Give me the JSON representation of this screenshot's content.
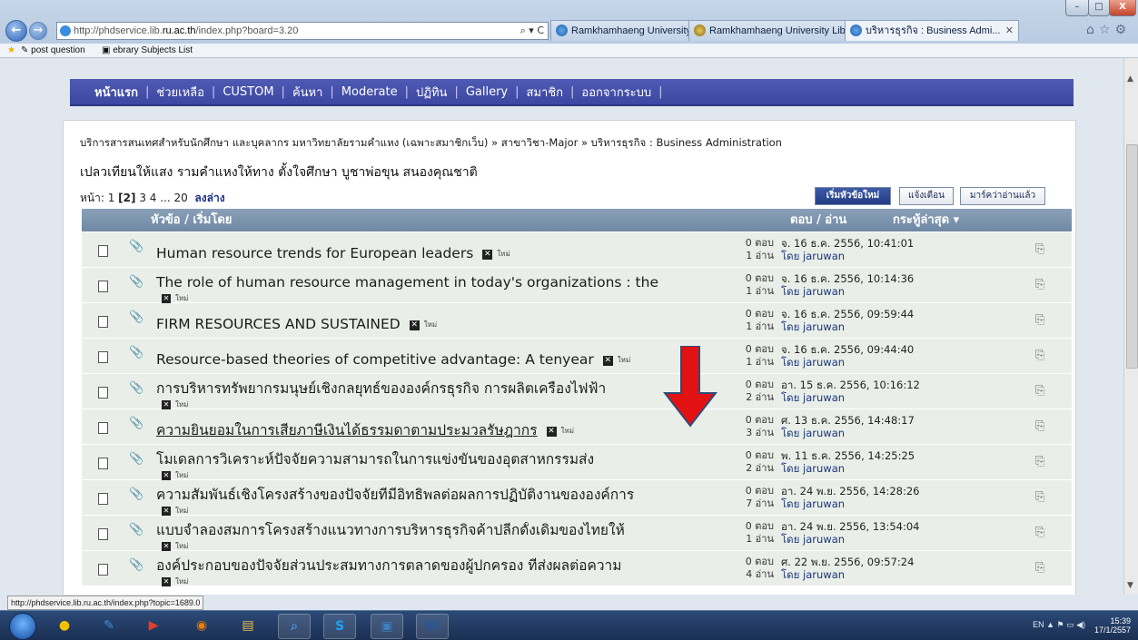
{
  "browser": {
    "address": {
      "prefix": "http://phdservice.lib.",
      "domain": "ru.ac.th",
      "suffix": "/index.php?board=3.20"
    },
    "addr_icons": "⌕ ▾ C",
    "tabs": [
      {
        "label": "Ramkhamhaeng University Lib..."
      },
      {
        "label": "Ramkhamhaeng University Lib..."
      },
      {
        "label": "บริหารธุรกิจ : Business Admi..."
      }
    ],
    "tab_close": "✕",
    "nav_right": "⌂☆⚙",
    "favorites": [
      "post question",
      "ebrary Subjects List"
    ],
    "window_buttons": {
      "minimize": "–",
      "maximize": "□",
      "close": "X"
    }
  },
  "menu": [
    "หน้าแรก",
    "ช่วยเหลือ",
    "CUSTOM",
    "ค้นหา",
    "Moderate",
    "ปฏิทิน",
    "Gallery",
    "สมาชิก",
    "ออกจากระบบ"
  ],
  "breadcrumb": "บริการสารสนเทศสำหรับนักศึกษา และบุคลากร มหาวิทยาลัยรามคำแหง (เฉพาะสมาชิกเว็บ) » สาขาวิชา-Major » บริหารธุรกิจ : Business Administration",
  "motto": "เปลวเทียนให้แสง รามคำแหงให้ทาง ตั้งใจศึกษา บูชาพ่อขุน สนองคุณชาติ",
  "pager": {
    "label": "หน้า: 1",
    "current": "[2]",
    "pages": "3 4 ... 20",
    "bottom": "ลงล่าง"
  },
  "buttons": {
    "new_topic": "เริ่มหัวข้อใหม่",
    "notify": "แจ้งเตือน",
    "mark_read": "มาร์คว่าอ่านแล้ว"
  },
  "table": {
    "col_subject": "หัวข้อ / เริ่มโดย",
    "col_replies": "ตอบ / อ่าน",
    "col_last": "กระทู้ล่าสุด ▾",
    "new_label": "ใหม่",
    "rows": [
      {
        "subject": "Human resource trends for European leaders",
        "replies": "0 ตอบ",
        "views": "1 อ่าน",
        "date": "จ. 16 ธ.ค. 2556, 10:41:01",
        "by": "โดย jaruwan",
        "new_inline": true
      },
      {
        "subject": "The role of human resource management in today's organizations : the",
        "replies": "0 ตอบ",
        "views": "1 อ่าน",
        "date": "จ. 16 ธ.ค. 2556, 10:14:36",
        "by": "โดย jaruwan",
        "new_inline": false
      },
      {
        "subject": "FIRM RESOURCES AND SUSTAINED",
        "replies": "0 ตอบ",
        "views": "1 อ่าน",
        "date": "จ. 16 ธ.ค. 2556, 09:59:44",
        "by": "โดย jaruwan",
        "new_inline": true
      },
      {
        "subject": "Resource-based theories of competitive advantage: A tenyear",
        "replies": "0 ตอบ",
        "views": "1 อ่าน",
        "date": "จ. 16 ธ.ค. 2556, 09:44:40",
        "by": "โดย jaruwan",
        "new_inline": true
      },
      {
        "subject": "การบริหารทรัพยากรมนุษย์เชิงกลยุทธ์ขององค์กรธุรกิจ การผลิตเครื่องไฟฟ้า",
        "replies": "0 ตอบ",
        "views": "2 อ่าน",
        "date": "อา. 15 ธ.ค. 2556, 10:16:12",
        "by": "โดย jaruwan",
        "new_inline": false
      },
      {
        "subject": "ความยินยอมในการเสียภาษีเงินได้ธรรมดาตามประมวลรัษฎากร",
        "replies": "0 ตอบ",
        "views": "3 อ่าน",
        "date": "ศ. 13 ธ.ค. 2556, 14:48:17",
        "by": "โดย jaruwan",
        "new_inline": true
      },
      {
        "subject": "โมเดลการวิเคราะห์ปัจจัยความสามารถในการแข่งขันของอุตสาหกรรมส่ง",
        "replies": "0 ตอบ",
        "views": "2 อ่าน",
        "date": "พ. 11 ธ.ค. 2556, 14:25:25",
        "by": "โดย jaruwan",
        "new_inline": false
      },
      {
        "subject": "ความสัมพันธ์เชิงโครงสร้างของปัจจัยที่มีอิทธิพลต่อผลการปฏิบัติงานขององค์การ",
        "replies": "0 ตอบ",
        "views": "7 อ่าน",
        "date": "อา. 24 พ.ย. 2556, 14:28:26",
        "by": "โดย jaruwan",
        "new_inline": false
      },
      {
        "subject": "แบบจำลองสมการโครงสร้างแนวทางการบริหารธุรกิจค้าปลีกดั้งเดิมของไทยให้",
        "replies": "0 ตอบ",
        "views": "1 อ่าน",
        "date": "อา. 24 พ.ย. 2556, 13:54:04",
        "by": "โดย jaruwan",
        "new_inline": false
      },
      {
        "subject": "องค์ประกอบของปัจจัยส่วนประสมทางการตลาดของผู้ปกครอง ที่ส่งผลต่อความ",
        "replies": "0 ตอบ",
        "views": "4 อ่าน",
        "date": "ศ. 22 พ.ย. 2556, 09:57:24",
        "by": "โดย jaruwan",
        "new_inline": false
      }
    ]
  },
  "status_url": "http://phdservice.lib.ru.ac.th/index.php?topic=1689.0",
  "taskbar": {
    "lang": "EN",
    "time": "15:39",
    "date": "17/1/2557",
    "apps": [
      "chrome",
      "media",
      "player",
      "firefox",
      "explorer",
      "search",
      "skype",
      "computer",
      "word"
    ],
    "app_glyphs": [
      "●",
      "✎",
      "▶",
      "◉",
      "▤",
      "⌕",
      "S",
      "▣",
      "W"
    ],
    "tray_glyphs": "▲ ⚑ ▭ ◀)"
  },
  "colors": {
    "menu_bg": "#3f4aa6",
    "row_bg": "#e9efe8",
    "header_bg": "#7b93ad",
    "arrow": "#e31212"
  }
}
